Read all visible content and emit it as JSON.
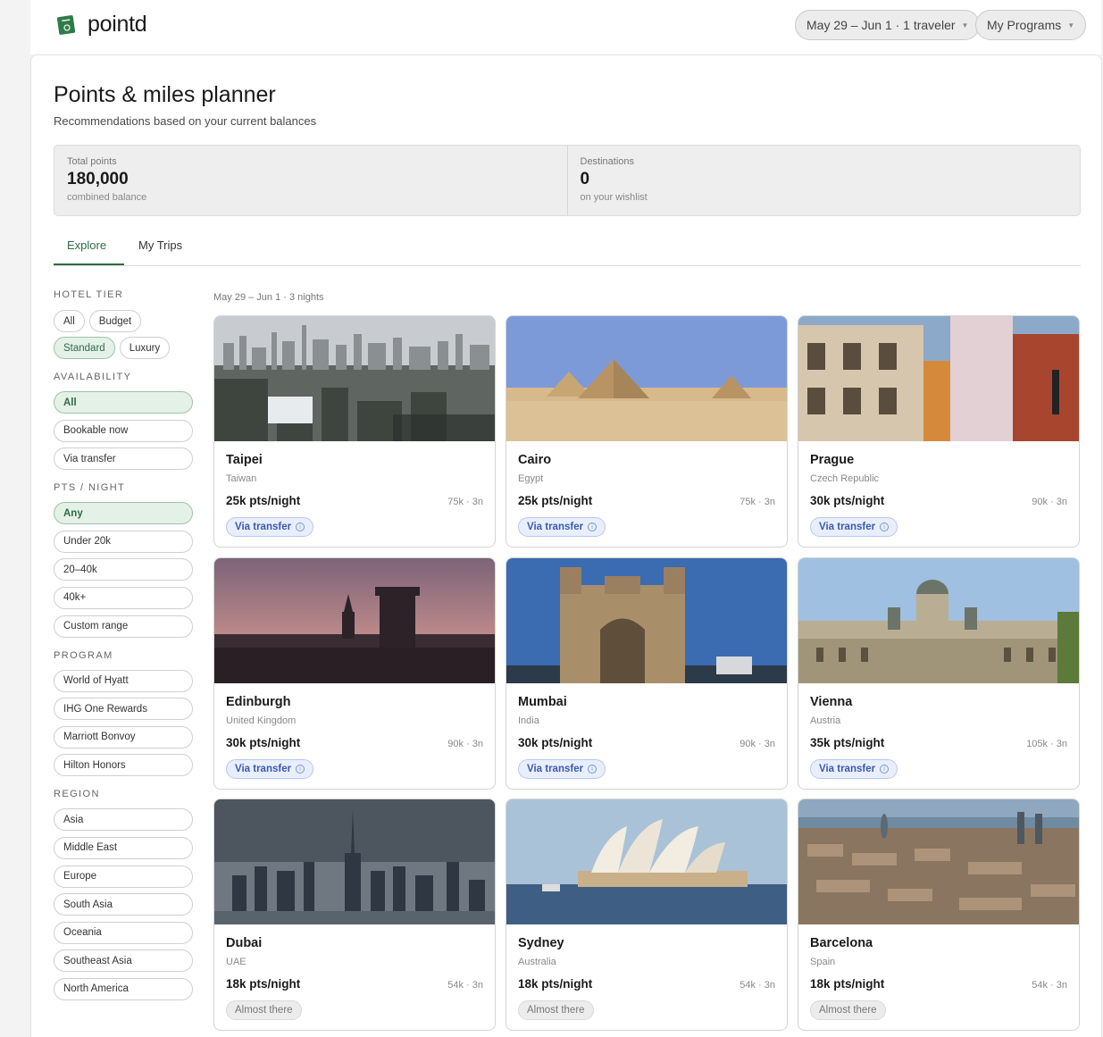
{
  "app": {
    "name": "pointd"
  },
  "header": {
    "trip_selector": "May 29 – Jun 1 · 1 traveler",
    "programs_button": "My Programs"
  },
  "page": {
    "title": "Points & miles planner",
    "subtitle": "Recommendations based on your current balances"
  },
  "stats": [
    {
      "label": "Total points",
      "value": "180,000",
      "note": "combined balance"
    },
    {
      "label": "Destinations",
      "value": "0",
      "note": "on your wishlist"
    }
  ],
  "tabs": [
    {
      "label": "Explore",
      "active": true
    },
    {
      "label": "My Trips",
      "active": false
    }
  ],
  "filters": {
    "hotel_tier": {
      "title": "HOTEL TIER",
      "options": [
        "All",
        "Budget",
        "Standard",
        "Luxury"
      ],
      "selected": "Standard"
    },
    "availability": {
      "title": "AVAILABILITY",
      "options": [
        "All",
        "Bookable now",
        "Via transfer"
      ],
      "selected": "All"
    },
    "pts_night": {
      "title": "PTS / NIGHT",
      "options": [
        "Any",
        "Under 20k",
        "20–40k",
        "40k+",
        "Custom range"
      ],
      "selected": "Any"
    },
    "program": {
      "title": "PROGRAM",
      "options": [
        "World of Hyatt",
        "IHG One Rewards",
        "Marriott Bonvoy",
        "Hilton Honors"
      ]
    },
    "region": {
      "title": "REGION",
      "options": [
        "Asia",
        "Middle East",
        "Europe",
        "South Asia",
        "Oceania",
        "Southeast Asia",
        "North America"
      ]
    }
  },
  "results": {
    "date_label": "May 29 – Jun 1 · 3 nights",
    "cards": [
      {
        "city": "Taipei",
        "country": "Taiwan",
        "pts_night": "25k pts/night",
        "total": "75k · 3n",
        "badge": "Via transfer",
        "badge_type": "transfer",
        "image": "taipei-skyline"
      },
      {
        "city": "Cairo",
        "country": "Egypt",
        "pts_night": "25k pts/night",
        "total": "75k · 3n",
        "badge": "Via transfer",
        "badge_type": "transfer",
        "image": "giza-pyramids"
      },
      {
        "city": "Prague",
        "country": "Czech Republic",
        "pts_night": "30k pts/night",
        "total": "90k · 3n",
        "badge": "Via transfer",
        "badge_type": "transfer",
        "image": "prague-facades"
      },
      {
        "city": "Edinburgh",
        "country": "United Kingdom",
        "pts_night": "30k pts/night",
        "total": "90k · 3n",
        "badge": "Via transfer",
        "badge_type": "transfer",
        "image": "edinburgh-sunset"
      },
      {
        "city": "Mumbai",
        "country": "India",
        "pts_night": "30k pts/night",
        "total": "90k · 3n",
        "badge": "Via transfer",
        "badge_type": "transfer",
        "image": "gateway-of-india"
      },
      {
        "city": "Vienna",
        "country": "Austria",
        "pts_night": "35k pts/night",
        "total": "105k · 3n",
        "badge": "Via transfer",
        "badge_type": "transfer",
        "image": "vienna-museum"
      },
      {
        "city": "Dubai",
        "country": "UAE",
        "pts_night": "18k pts/night",
        "total": "54k · 3n",
        "badge": "Almost there",
        "badge_type": "almost",
        "image": "dubai-skyline"
      },
      {
        "city": "Sydney",
        "country": "Australia",
        "pts_night": "18k pts/night",
        "total": "54k · 3n",
        "badge": "Almost there",
        "badge_type": "almost",
        "image": "sydney-opera-house"
      },
      {
        "city": "Barcelona",
        "country": "Spain",
        "pts_night": "18k pts/night",
        "total": "54k · 3n",
        "badge": "Almost there",
        "badge_type": "almost",
        "image": "barcelona-aerial"
      }
    ]
  },
  "colors": {
    "accent": "#2f6b45",
    "selected_bg": "#e4f1e7",
    "transfer_blue": "#3a5bb3"
  }
}
